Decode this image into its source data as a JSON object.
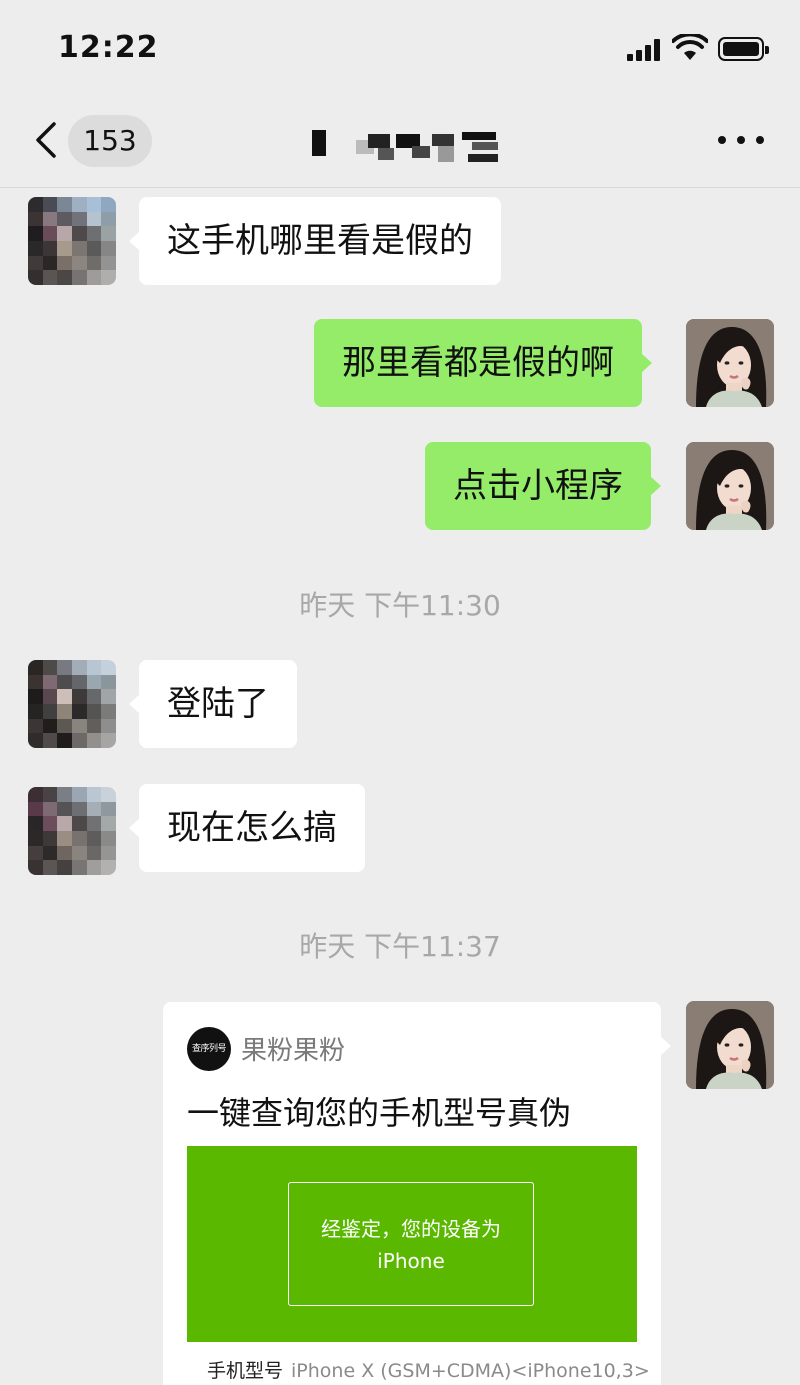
{
  "status_bar": {
    "time": "12:22"
  },
  "nav": {
    "unread_count": "153",
    "title_redacted": true
  },
  "messages": [
    {
      "from": "other",
      "text": "这手机哪里看是假的"
    },
    {
      "from": "self",
      "text": "那里看都是假的啊"
    },
    {
      "from": "self",
      "text": "点击小程序"
    },
    {
      "type": "timestamp",
      "text": "昨天 下午11:30"
    },
    {
      "from": "other",
      "text": "登陆了"
    },
    {
      "from": "other",
      "text": "现在怎么搞"
    },
    {
      "type": "timestamp",
      "text": "昨天 下午11:37"
    }
  ],
  "card": {
    "logo_text": "查序列号",
    "source": "果粉果粉",
    "title": "一键查询您的手机型号真伪",
    "image_line1": "经鉴定，您的设备为",
    "image_line2": "iPhone",
    "model_label": "手机型号",
    "model_value": "iPhone X (GSM+CDMA)<iPhone10,3>",
    "image_color": "#5bb800"
  },
  "colors": {
    "background": "#ededed",
    "bubble_out": "#95ec69",
    "bubble_in": "#ffffff"
  }
}
